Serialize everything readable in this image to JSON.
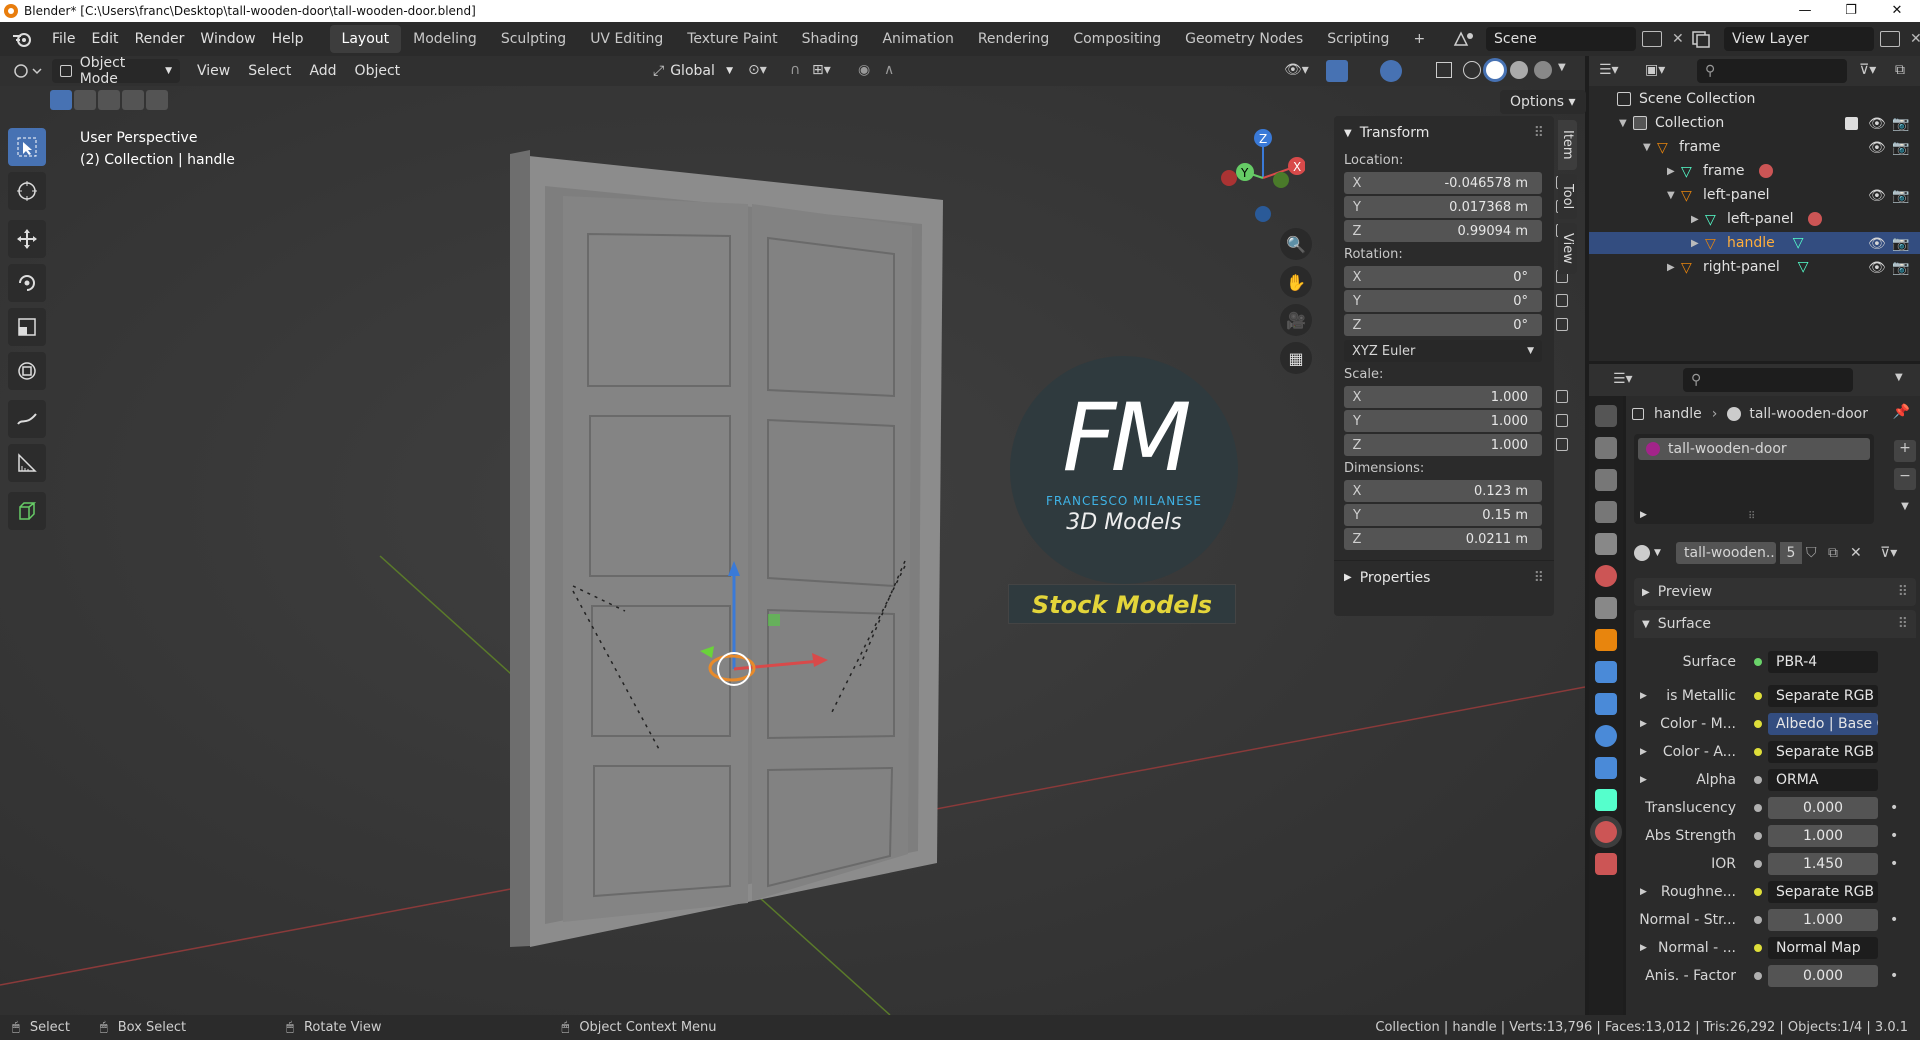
{
  "window": {
    "title": "Blender* [C:\\Users\\franc\\Desktop\\tall-wooden-door\\tall-wooden-door.blend]",
    "controls": [
      "—",
      "❐",
      "✕"
    ]
  },
  "menu": [
    "File",
    "Edit",
    "Render",
    "Window",
    "Help"
  ],
  "workspaces": [
    {
      "label": "Layout",
      "active": true
    },
    {
      "label": "Modeling"
    },
    {
      "label": "Sculpting"
    },
    {
      "label": "UV Editing"
    },
    {
      "label": "Texture Paint"
    },
    {
      "label": "Shading"
    },
    {
      "label": "Animation"
    },
    {
      "label": "Rendering"
    },
    {
      "label": "Compositing"
    },
    {
      "label": "Geometry Nodes"
    },
    {
      "label": "Scripting"
    }
  ],
  "add_workspace": "+",
  "scene": "Scene",
  "view_layer": "View Layer",
  "viewport_header": {
    "mode": "Object Mode",
    "menus": [
      "View",
      "Select",
      "Add",
      "Object"
    ],
    "orientation": "Global",
    "options": "Options"
  },
  "viewport_info": {
    "perspective": "User Perspective",
    "collection": "(2) Collection | handle"
  },
  "gizmo": {
    "x": "X",
    "y": "Y",
    "z": "Z"
  },
  "watermark": {
    "logo": "FM",
    "name": "FRANCESCO MILANESE",
    "sub": "3D Models",
    "badge": "Stock Models"
  },
  "npanel": {
    "tabs": [
      "Item",
      "Tool",
      "View"
    ],
    "transform_title": "Transform",
    "location_label": "Location:",
    "location": [
      {
        "axis": "X",
        "value": "-0.046578 m"
      },
      {
        "axis": "Y",
        "value": "0.017368 m"
      },
      {
        "axis": "Z",
        "value": "0.99094 m"
      }
    ],
    "rotation_label": "Rotation:",
    "rotation": [
      {
        "axis": "X",
        "value": "0°"
      },
      {
        "axis": "Y",
        "value": "0°"
      },
      {
        "axis": "Z",
        "value": "0°"
      }
    ],
    "rotation_mode": "XYZ Euler",
    "scale_label": "Scale:",
    "scale": [
      {
        "axis": "X",
        "value": "1.000"
      },
      {
        "axis": "Y",
        "value": "1.000"
      },
      {
        "axis": "Z",
        "value": "1.000"
      }
    ],
    "dimensions_label": "Dimensions:",
    "dimensions": [
      {
        "axis": "X",
        "value": "0.123 m"
      },
      {
        "axis": "Y",
        "value": "0.15 m"
      },
      {
        "axis": "Z",
        "value": "0.0211 m"
      }
    ],
    "properties_title": "Properties"
  },
  "outliner": {
    "rows": [
      {
        "label": "Scene Collection"
      },
      {
        "label": "Collection"
      },
      {
        "label": "frame"
      },
      {
        "label": "frame"
      },
      {
        "label": "left-panel"
      },
      {
        "label": "left-panel"
      },
      {
        "label": "handle"
      },
      {
        "label": "right-panel"
      }
    ]
  },
  "properties": {
    "breadcrumb_object": "handle",
    "breadcrumb_material": "tall-wooden-door",
    "slot": "tall-wooden-door",
    "material_name": "tall-wooden...",
    "users": "5",
    "preview": "Preview",
    "surface_panel": "Surface",
    "rows": [
      {
        "label": "Surface",
        "value": "PBR-4",
        "dot": "#6ad36a",
        "kind": "sock"
      },
      {
        "label": "is Metallic",
        "value": "Separate RGB",
        "dot": "#dede3a",
        "kind": "sock",
        "expand": true
      },
      {
        "label": "Color - M...",
        "value": "Albedo | Base C...",
        "dot": "#dede3a",
        "kind": "link",
        "expand": true
      },
      {
        "label": "Color - A...",
        "value": "Separate RGB",
        "dot": "#dede3a",
        "kind": "sock",
        "expand": true
      },
      {
        "label": "Alpha",
        "value": "ORMA",
        "dot": "#b0b0b0",
        "kind": "sock",
        "expand": true
      },
      {
        "label": "Translucency",
        "value": "0.000",
        "dot": "#b0b0b0",
        "kind": "num"
      },
      {
        "label": "Abs Strength",
        "value": "1.000",
        "dot": "#b0b0b0",
        "kind": "num"
      },
      {
        "label": "IOR",
        "value": "1.450",
        "dot": "#b0b0b0",
        "kind": "num"
      },
      {
        "label": "Roughne...",
        "value": "Separate RGB",
        "dot": "#dede3a",
        "kind": "sock",
        "expand": true
      },
      {
        "label": "Normal - Str...",
        "value": "1.000",
        "dot": "#b0b0b0",
        "kind": "num"
      },
      {
        "label": "Normal - ...",
        "value": "Normal Map",
        "dot": "#dede3a",
        "kind": "sock",
        "expand": true
      },
      {
        "label": "Anis. - Factor",
        "value": "0.000",
        "dot": "#b0b0b0",
        "kind": "num"
      }
    ]
  },
  "statusbar": {
    "left": [
      "Select",
      "Box Select",
      "Rotate View",
      "Object Context Menu"
    ],
    "right": "Collection | handle | Verts:13,796 | Faces:13,012 | Tris:26,292 | Objects:1/4 | 3.0.1"
  },
  "colors": {
    "accent": "#4772b3",
    "orange": "#e8850d",
    "selected_row": "#334d80",
    "watermark_cyan": "#3fb3e6",
    "badge_yellow": "#e3d53a"
  }
}
